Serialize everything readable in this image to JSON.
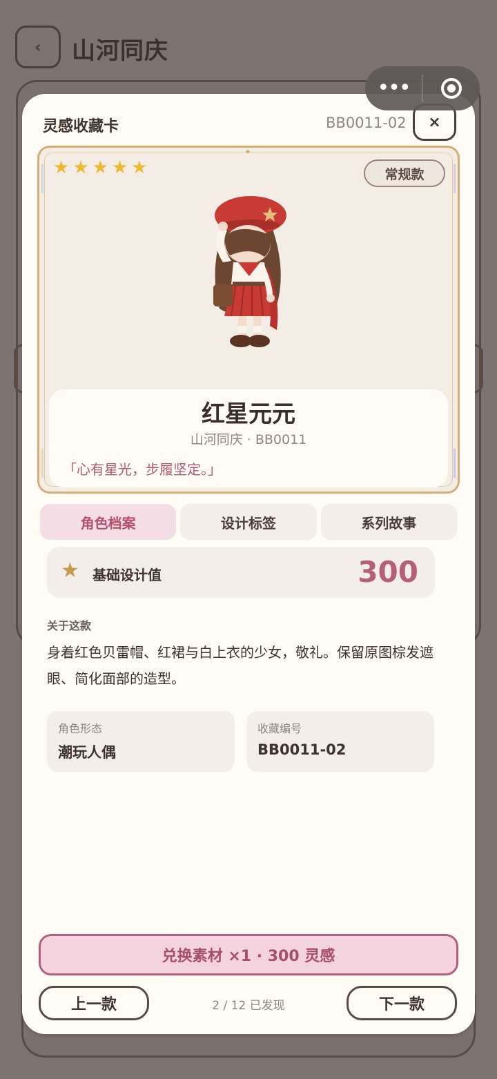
{
  "background": {
    "back_glyph": "‹",
    "title": "山河同庆"
  },
  "capsule": {
    "more_glyph": "•••",
    "icons": [
      "more-dots-icon",
      "target-circle-icon"
    ]
  },
  "modal": {
    "header_title": "灵感收藏卡",
    "header_code": "BB0011-02",
    "close_glyph": "×"
  },
  "card": {
    "stars": 5,
    "star_glyph": "★",
    "rarity": "常规款",
    "name": "红星元元",
    "subtitle": "山河同庆 · BB0011",
    "quote": "「心有星光，步履坚定。」"
  },
  "tabs": [
    {
      "label": "角色档案",
      "active": true
    },
    {
      "label": "设计标签",
      "active": false
    },
    {
      "label": "系列故事",
      "active": false
    }
  ],
  "stat": {
    "icon_glyph": "★",
    "label": "基础设计值",
    "value": "300"
  },
  "about": {
    "label": "关于这款",
    "text": "身着红色贝雷帽、红裙与白上衣的少女，敬礼。保留原图棕发遮眼、简化面部的造型。"
  },
  "attributes": [
    {
      "key": "角色形态",
      "value": "潮玩人偶"
    },
    {
      "key": "收藏编号",
      "value": "BB0011-02"
    }
  ],
  "actions": {
    "redeem": "兑换素材 ×1 · 300 灵感",
    "prev": "上一款",
    "next": "下一款",
    "progress": "2 / 12 已发现"
  },
  "colors": {
    "accent": "#b4607a",
    "star": "#efb92f",
    "gold_frame": "#d4ad77"
  }
}
